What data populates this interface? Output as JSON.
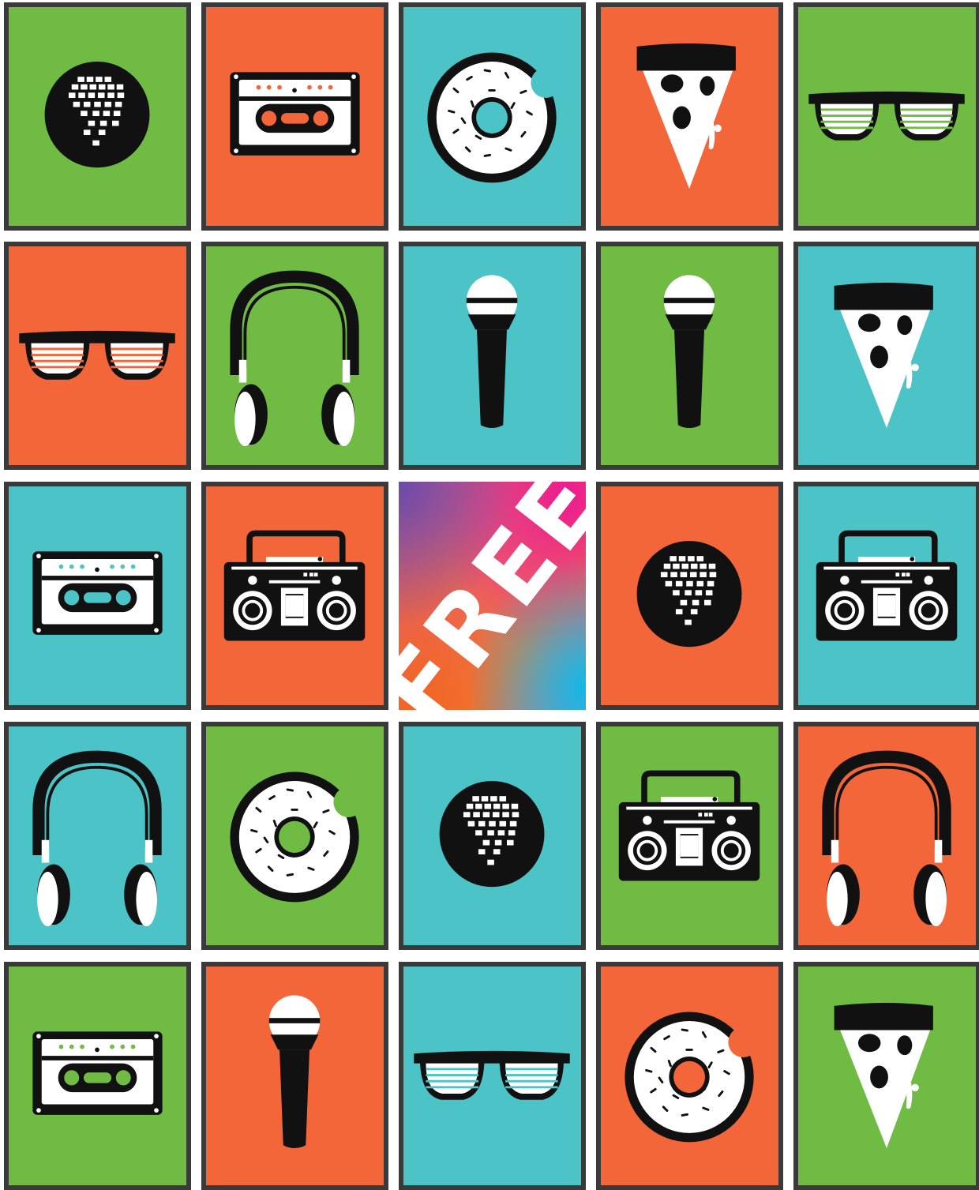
{
  "board": {
    "free_label": "FREE",
    "colors": {
      "green": "#6fbb44",
      "orange": "#f2663a",
      "teal": "#4bc3c7",
      "border": "#3a3a3a",
      "ink": "#111111"
    },
    "rows": [
      [
        {
          "icon": "disco-ball-icon",
          "bg": "green"
        },
        {
          "icon": "cassette-tape-icon",
          "bg": "orange"
        },
        {
          "icon": "donut-icon",
          "bg": "teal"
        },
        {
          "icon": "pizza-slice-icon",
          "bg": "orange"
        },
        {
          "icon": "shutter-shades-icon",
          "bg": "green"
        }
      ],
      [
        {
          "icon": "shutter-shades-icon",
          "bg": "orange"
        },
        {
          "icon": "headphones-icon",
          "bg": "green"
        },
        {
          "icon": "microphone-icon",
          "bg": "teal"
        },
        {
          "icon": "microphone-icon",
          "bg": "green"
        },
        {
          "icon": "pizza-slice-icon",
          "bg": "teal"
        }
      ],
      [
        {
          "icon": "cassette-tape-icon",
          "bg": "teal"
        },
        {
          "icon": "boombox-icon",
          "bg": "orange"
        },
        {
          "icon": "free-space",
          "bg": "free"
        },
        {
          "icon": "disco-ball-icon",
          "bg": "orange"
        },
        {
          "icon": "boombox-icon",
          "bg": "teal"
        }
      ],
      [
        {
          "icon": "headphones-icon",
          "bg": "teal"
        },
        {
          "icon": "donut-icon",
          "bg": "green"
        },
        {
          "icon": "disco-ball-icon",
          "bg": "teal"
        },
        {
          "icon": "boombox-icon",
          "bg": "green"
        },
        {
          "icon": "headphones-icon",
          "bg": "orange"
        }
      ],
      [
        {
          "icon": "cassette-tape-icon",
          "bg": "green"
        },
        {
          "icon": "microphone-icon",
          "bg": "orange"
        },
        {
          "icon": "shutter-shades-icon",
          "bg": "teal"
        },
        {
          "icon": "donut-icon",
          "bg": "orange"
        },
        {
          "icon": "pizza-slice-icon",
          "bg": "green"
        }
      ]
    ]
  }
}
